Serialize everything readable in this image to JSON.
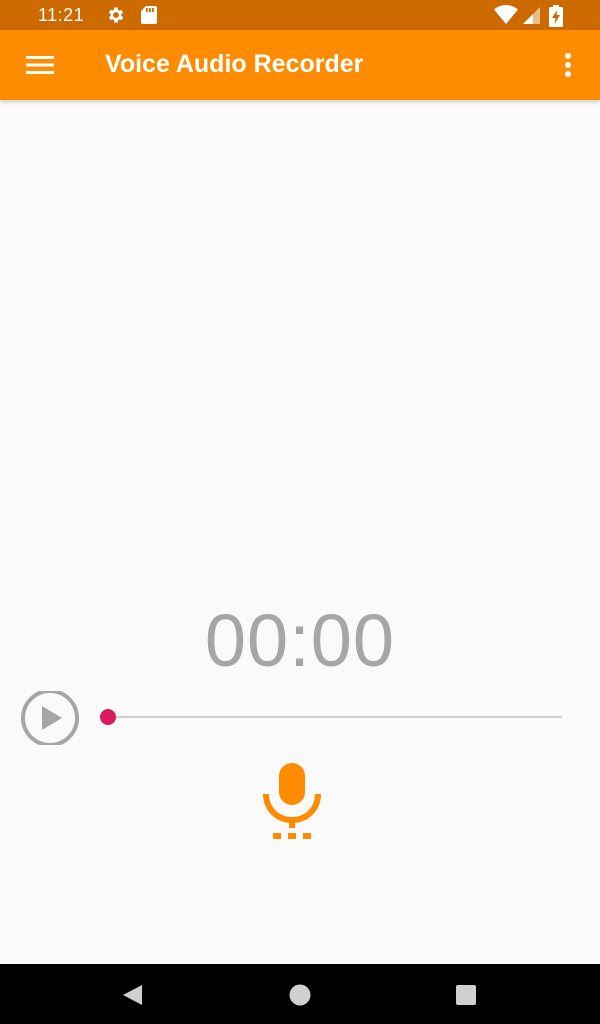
{
  "status_bar": {
    "time": "11:21",
    "icons": [
      "settings-icon",
      "sd-card-icon",
      "wifi-icon",
      "signal-icon",
      "battery-charging-icon"
    ]
  },
  "app_bar": {
    "title": "Voice Audio Recorder",
    "menu_icon": "hamburger-menu-icon",
    "overflow_icon": "more-vert-icon"
  },
  "recorder": {
    "timer": "00:00",
    "progress": 0.0,
    "play_icon": "play-circle-icon",
    "record_icon": "microphone-icon"
  },
  "nav_bar": {
    "icons": [
      "back-icon",
      "home-icon",
      "recents-icon"
    ]
  },
  "colors": {
    "status_bar": "#cc6a00",
    "app_bar": "#ff8b00",
    "accent": "#ff8b00",
    "seek_thumb": "#d81b60",
    "timer_text": "#a6a6a6",
    "background": "#fafafa"
  }
}
